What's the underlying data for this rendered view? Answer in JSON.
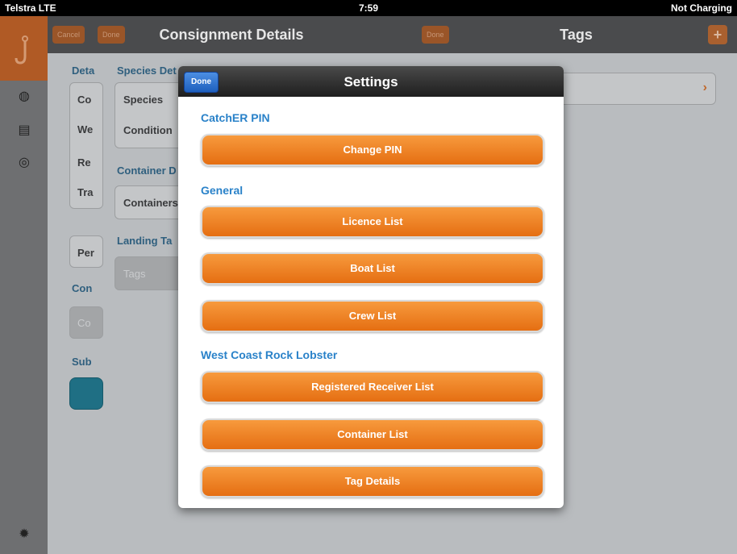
{
  "status_bar": {
    "carrier": "Telstra  LTE",
    "time": "7:59",
    "battery": "Not Charging"
  },
  "left_pane": {
    "title": "Consignment Details",
    "cancel_label": "Cancel",
    "done_label": "Done",
    "col1": [
      "Deta",
      "Co",
      "We",
      "Re",
      "Tra",
      "Per",
      "Con",
      "Co",
      "Sub"
    ],
    "col2": {
      "species_header": "Species Det",
      "species": "Species",
      "condition": "Condition",
      "container_header": "Container D",
      "containers": "Containers",
      "landing_header": "Landing Ta",
      "tags": "Tags"
    }
  },
  "right_pane": {
    "title": "Tags",
    "done_label": "Done",
    "add_label": "+"
  },
  "modal": {
    "title": "Settings",
    "done_label": "Done",
    "sections": [
      {
        "title": "CatchER PIN",
        "buttons": [
          "Change PIN"
        ]
      },
      {
        "title": "General",
        "buttons": [
          "Licence List",
          "Boat List",
          "Crew List"
        ]
      },
      {
        "title": "West Coast Rock Lobster",
        "buttons": [
          "Registered Receiver List",
          "Container List",
          "Tag Details"
        ]
      }
    ]
  }
}
